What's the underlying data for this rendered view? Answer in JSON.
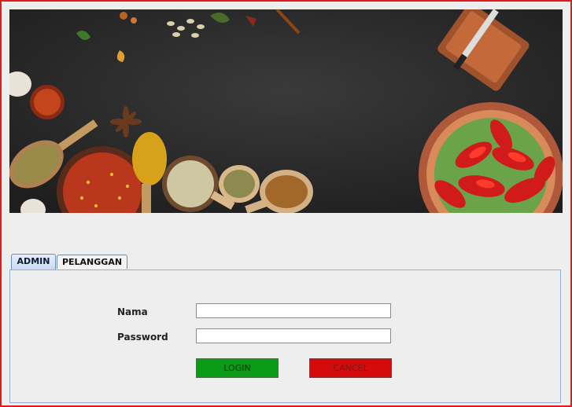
{
  "banner": {
    "image": "spices-and-crawfish-photo"
  },
  "tabs": [
    {
      "label": "ADMIN",
      "active": true
    },
    {
      "label": "PELANGGAN",
      "active": false
    }
  ],
  "form": {
    "nama_label": "Nama",
    "nama_value": "",
    "password_label": "Password",
    "password_value": ""
  },
  "buttons": {
    "login_label": "LOGIN",
    "cancel_label": "CANCEL"
  },
  "colors": {
    "frame": "#e01b1b",
    "login": "#0a9a16",
    "cancel": "#d40b0b",
    "banner_bg": "#2b2b2b"
  }
}
